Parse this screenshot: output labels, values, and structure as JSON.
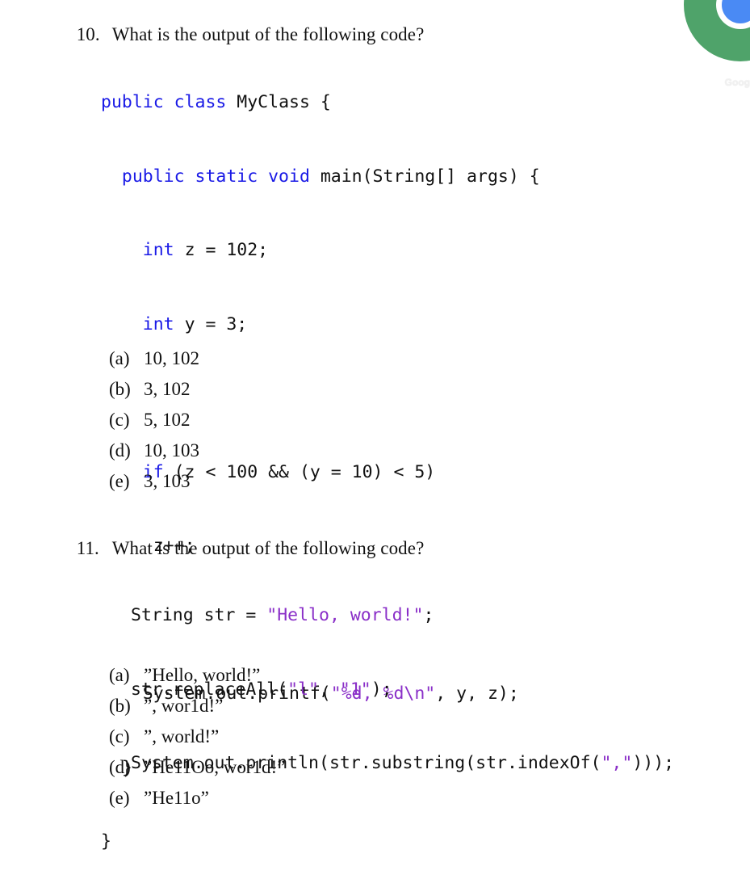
{
  "overlay": {
    "logo_icon": "chrome-logo-icon",
    "logo_text": "Goog",
    "colors": {
      "green": "#4fa36a",
      "red": "#c5463a",
      "blue": "#4a8af4"
    }
  },
  "syntax_colors": {
    "keyword": "#1a1ae6",
    "string": "#8a2fc8"
  },
  "questions": [
    {
      "number": "10.",
      "prompt": "What is the output of the following code?",
      "code": [
        "public class MyClass {",
        "  public static void main(String[] args) {",
        "    int z = 102;",
        "    int y = 3;",
        "",
        "    if (z < 100 && (y = 10) < 5)",
        "     z++;",
        "",
        "    System.out.printf(\"%d, %d\\n\", y, z);",
        "  }",
        "}"
      ],
      "code_tokens": {
        "l0_kw": "public class",
        "l0_rest": " MyClass {",
        "l1_kw": "public static void",
        "l1_rest": " main(String[] args) {",
        "l2_kw": "int",
        "l2_rest": " z = 102;",
        "l3_kw": "int",
        "l3_rest": " y = 3;",
        "l5_kw": "if",
        "l5_rest": " (z < 100 && (y = 10) < 5)",
        "l6": "z++;",
        "l8_a": "System.out.printf(",
        "l8_str": "\"%d, %d\\n\"",
        "l8_b": ", y, z);",
        "l9": "}",
        "l10": "}"
      },
      "options": [
        {
          "label": "(a)",
          "text": "10, 102"
        },
        {
          "label": "(b)",
          "text": "3, 102"
        },
        {
          "label": "(c)",
          "text": "5, 102"
        },
        {
          "label": "(d)",
          "text": "10, 103"
        },
        {
          "label": "(e)",
          "text": "3, 103"
        }
      ]
    },
    {
      "number": "11.",
      "prompt": "What is the output of the following code?",
      "code": [
        "String str = \"Hello, world!\";",
        "str.replaceAll(\"l\", \"1\");",
        "System.out.println(str.substring(str.indexOf(\",\")));"
      ],
      "code_tokens": {
        "l0_a": "String str = ",
        "l0_str": "\"Hello, world!\"",
        "l0_b": ";",
        "l1_a": "str.replaceAll(",
        "l1_str1": "\"l\"",
        "l1_mid": ", ",
        "l1_str2": "\"1\"",
        "l1_b": ");",
        "l2_a": "System.out.println(str.substring(str.indexOf(",
        "l2_str": "\",\"",
        "l2_b": ")));"
      },
      "options": [
        {
          "label": "(a)",
          "text": "”Hello, world!”"
        },
        {
          "label": "(b)",
          "text": "”, wor1d!”"
        },
        {
          "label": "(c)",
          "text": "”, world!”"
        },
        {
          "label": "(d)",
          "text": "”He11Oo, wor1d!”"
        },
        {
          "label": "(e)",
          "text": "”He11o”"
        }
      ]
    }
  ]
}
